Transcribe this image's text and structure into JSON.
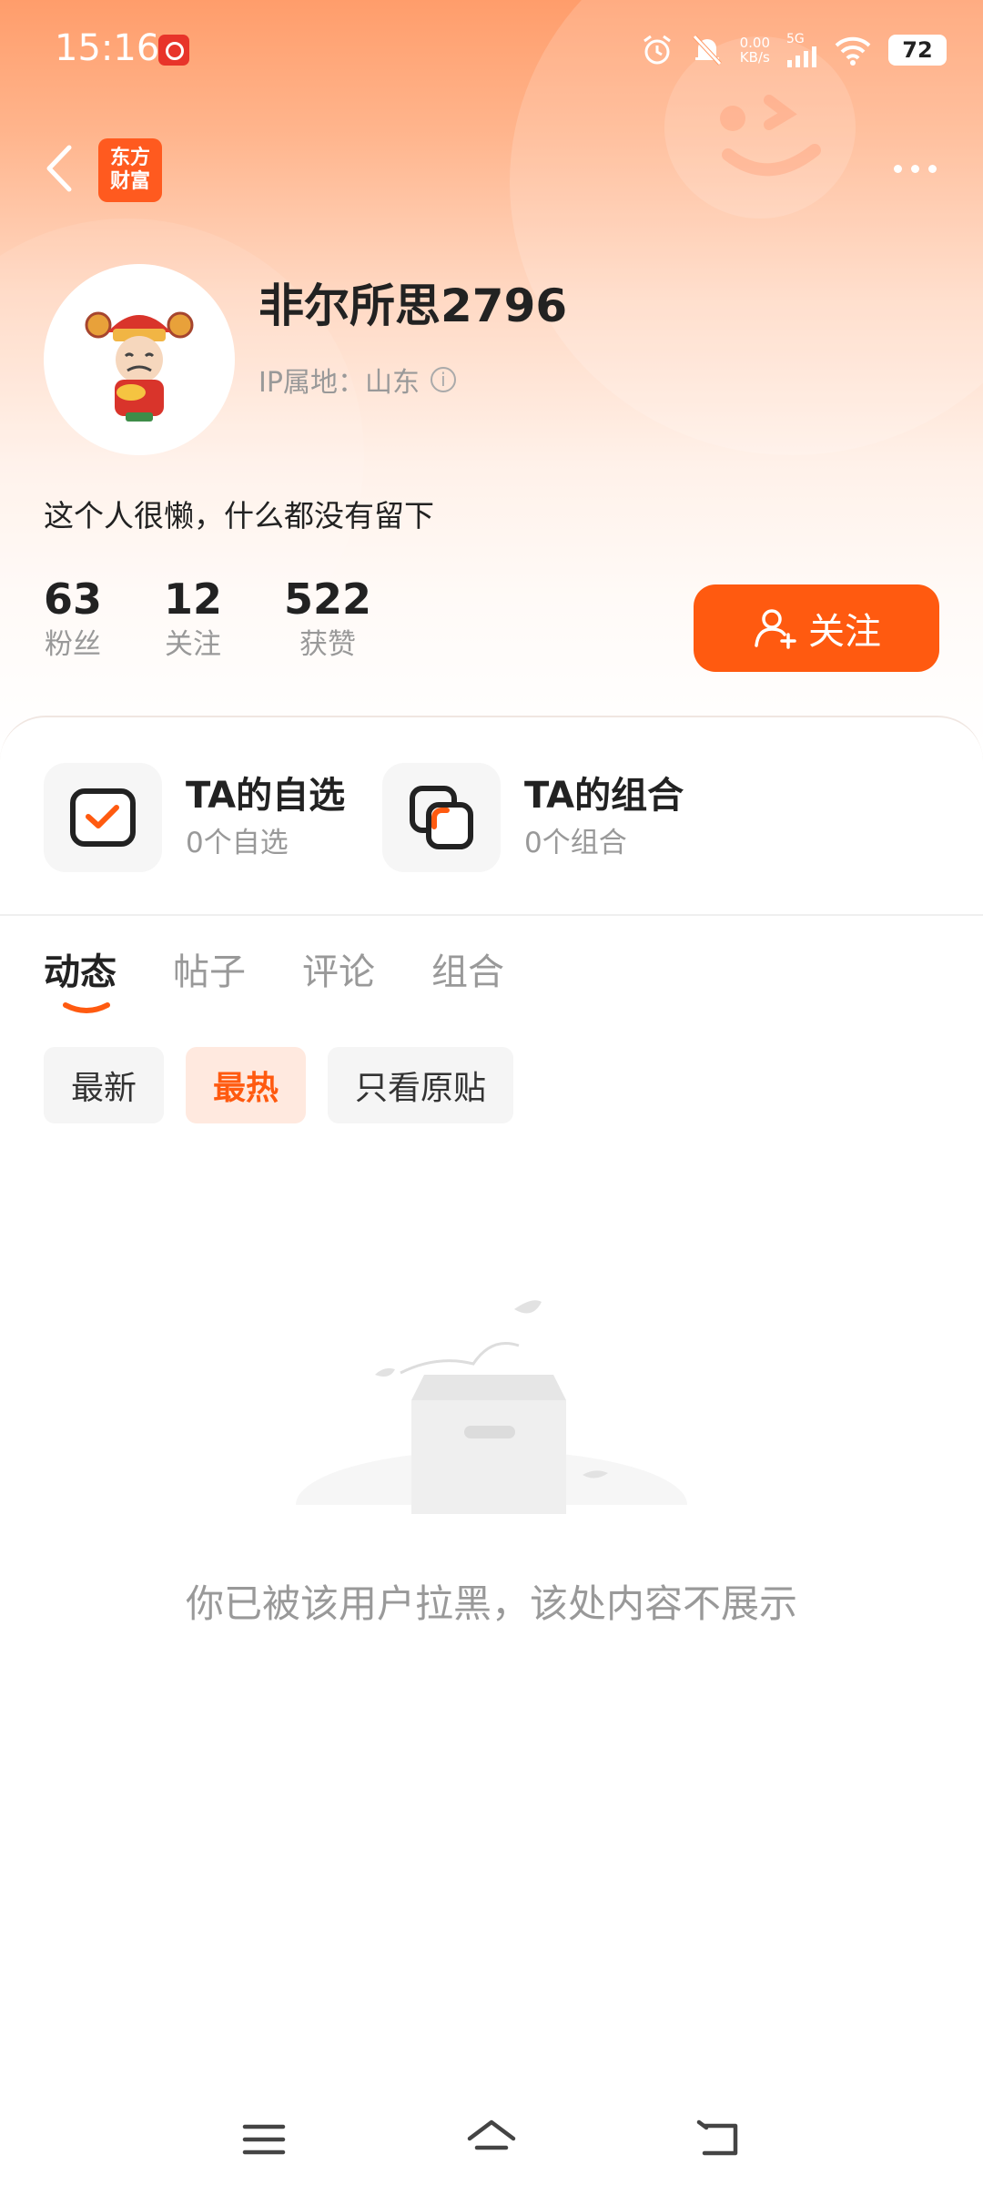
{
  "status_bar": {
    "time": "15:16",
    "net_speed_value": "0.00",
    "net_speed_unit": "KB/s",
    "network_type": "5G",
    "battery": "72"
  },
  "header": {
    "logo_text": "东方\n财富"
  },
  "profile": {
    "username": "非尔所思2796",
    "ip_location": "IP属地：山东",
    "bio": "这个人很懒，什么都没有留下",
    "stats": [
      {
        "value": "63",
        "label": "粉丝"
      },
      {
        "value": "12",
        "label": "关注"
      },
      {
        "value": "522",
        "label": "获赞"
      }
    ],
    "follow_label": "关注"
  },
  "quick_links": [
    {
      "title": "TA的自选",
      "subtitle": "0个自选"
    },
    {
      "title": "TA的组合",
      "subtitle": "0个组合"
    }
  ],
  "tabs": [
    "动态",
    "帖子",
    "评论",
    "组合"
  ],
  "filters": [
    "最新",
    "最热",
    "只看原贴"
  ],
  "empty_message": "你已被该用户拉黑，该处内容不展示",
  "colors": {
    "accent": "#ff5a10",
    "header_gradient_top": "#ff9d6b",
    "muted_text": "#999999"
  }
}
